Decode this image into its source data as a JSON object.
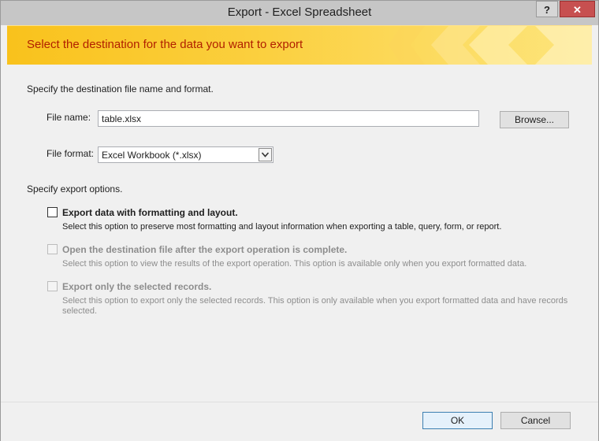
{
  "window": {
    "title": "Export - Excel Spreadsheet",
    "help_label": "?",
    "close_label": "✕"
  },
  "banner": {
    "title": "Select the destination for the data you want to export"
  },
  "destination": {
    "heading": "Specify the destination file name and format.",
    "file_name_label": "File name:",
    "file_name_value": "table.xlsx",
    "browse_label": "Browse...",
    "file_format_label": "File format:",
    "file_format_value": "Excel Workbook (*.xlsx)"
  },
  "options": {
    "heading": "Specify export options.",
    "items": [
      {
        "label": "Export data with formatting and layout.",
        "description": "Select this option to preserve most formatting and layout information when exporting a table, query, form, or report.",
        "checked": false,
        "enabled": true
      },
      {
        "label": "Open the destination file after the export operation is complete.",
        "description": "Select this option to view the results of the export operation. This option is available only when you export formatted data.",
        "checked": false,
        "enabled": false
      },
      {
        "label": "Export only the selected records.",
        "description": "Select this option to export only the selected records. This option is only available when you export formatted data and have records",
        "description_2": "selected.",
        "checked": false,
        "enabled": false
      }
    ]
  },
  "footer": {
    "ok_label": "OK",
    "cancel_label": "Cancel"
  },
  "colors": {
    "banner": "#fbc824",
    "banner_text": "#b12000",
    "close_button": "#c75050",
    "ok_border": "#3c7fb1"
  }
}
